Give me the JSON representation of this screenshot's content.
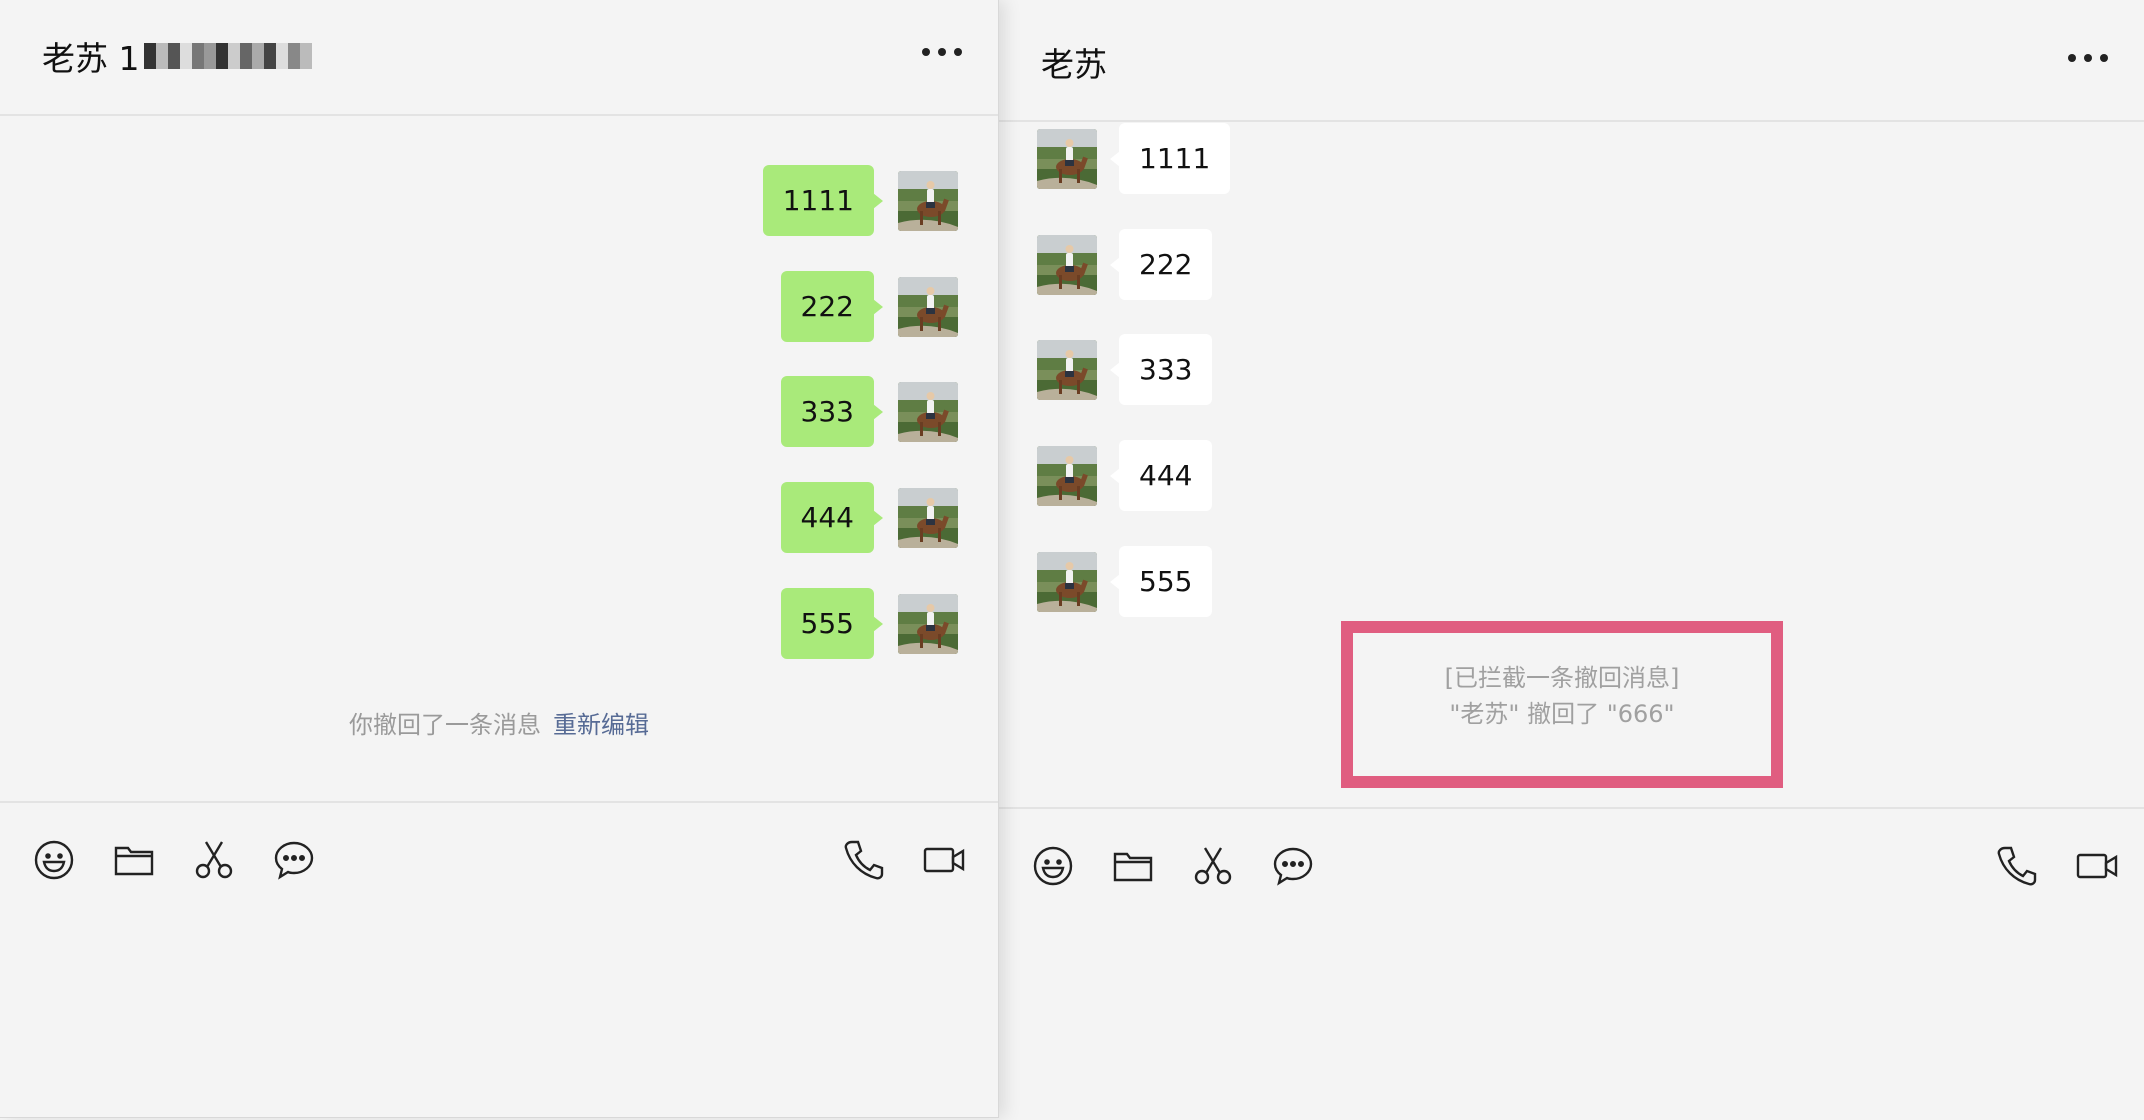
{
  "colors": {
    "sent_bubble": "#a9ea7a",
    "recv_bubble": "#ffffff",
    "link": "#576b95",
    "highlight": "#e05d80"
  },
  "left": {
    "title": "老苏 1",
    "messages": [
      "1111",
      "222",
      "333",
      "444",
      "555"
    ],
    "recall_notice": "你撤回了一条消息",
    "reedit_label": "重新编辑",
    "toolbar": [
      "emoji-icon",
      "folder-icon",
      "scissors-icon",
      "chat-bubble-icon",
      "phone-icon",
      "video-camera-icon"
    ]
  },
  "right": {
    "title": "老苏",
    "messages": [
      "1111",
      "222",
      "333",
      "444",
      "555"
    ],
    "intercept_line1": "[已拦截一条撤回消息]",
    "intercept_line2": "\"老苏\" 撤回了 \"666\"",
    "toolbar": [
      "emoji-icon",
      "folder-icon",
      "scissors-icon",
      "chat-bubble-icon",
      "phone-icon",
      "video-camera-icon"
    ]
  }
}
